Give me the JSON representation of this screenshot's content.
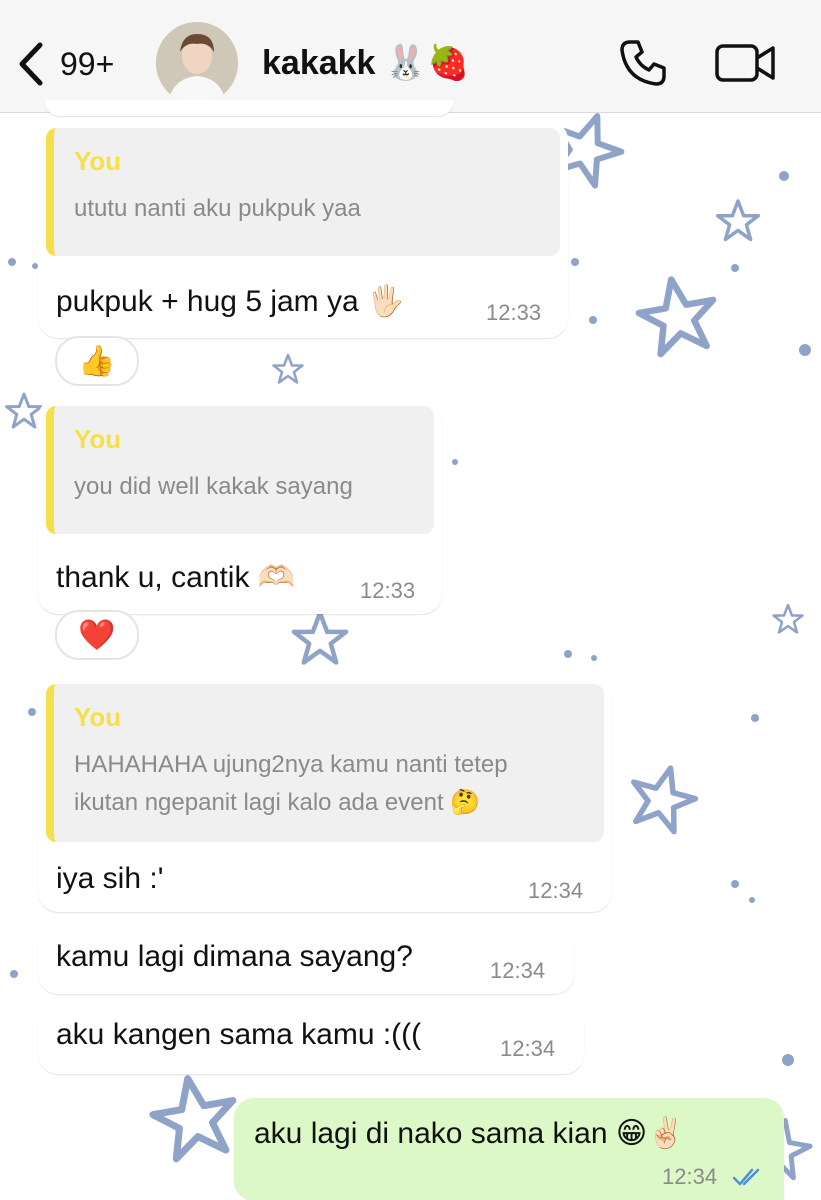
{
  "header": {
    "unread_count": "99+",
    "contact_name": "kakakk 🐰🍓"
  },
  "messages": [
    {
      "quote_author": "You",
      "quote_text": "ututu nanti aku pukpuk yaa",
      "text": "pukpuk + hug 5 jam ya 🖐🏻",
      "time": "12:33",
      "reaction": "👍"
    },
    {
      "quote_author": "You",
      "quote_text": "you did well kakak sayang",
      "text": "thank u, cantik 🫶🏻",
      "time": "12:33",
      "reaction": "❤️"
    },
    {
      "quote_author": "You",
      "quote_text": "HAHAHAHA ujung2nya kamu nanti tetep\nikutan ngepanit lagi kalo ada event 🤔",
      "text": "iya sih :'",
      "time": "12:34"
    },
    {
      "text": "kamu lagi dimana sayang?",
      "time": "12:34"
    },
    {
      "text": "aku kangen sama kamu :(((",
      "time": "12:34"
    }
  ],
  "outgoing": {
    "text": "aku lagi di nako sama kian 😁✌🏻",
    "time": "12:34",
    "status": "read-double-check-icon"
  },
  "colors": {
    "quote_accent": "#f5e04c",
    "outgoing_bubble": "#dcf8c6",
    "read_tick": "#4a90e2",
    "star_outline": "#8fa3c8"
  }
}
